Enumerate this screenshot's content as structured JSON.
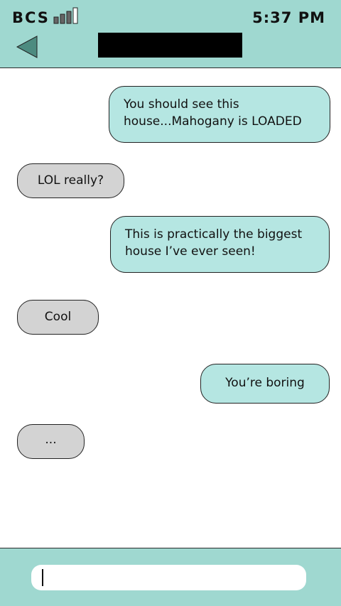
{
  "status_bar": {
    "carrier": "BCS",
    "time": "5:37 PM",
    "signal_bars_filled": 3,
    "signal_bars_total": 4
  },
  "header": {
    "back_icon": "back-arrow-icon",
    "contact_name": ""
  },
  "messages": [
    {
      "direction": "sent",
      "lines": [
        "You should see this",
        "house...Mahogany is LOADED"
      ]
    },
    {
      "direction": "received",
      "lines": [
        "LOL really?"
      ]
    },
    {
      "direction": "sent",
      "lines": [
        "This is practically the biggest",
        "house I’ve ever seen!"
      ]
    },
    {
      "direction": "received",
      "lines": [
        "Cool"
      ]
    },
    {
      "direction": "sent",
      "lines": [
        "You’re boring"
      ]
    },
    {
      "direction": "received",
      "lines": [
        "..."
      ]
    }
  ],
  "composer": {
    "value": "",
    "placeholder": ""
  },
  "colors": {
    "header_bg": "#9fd8d0",
    "sent_bubble": "#b5e6e2",
    "received_bubble": "#d3d3d3"
  }
}
